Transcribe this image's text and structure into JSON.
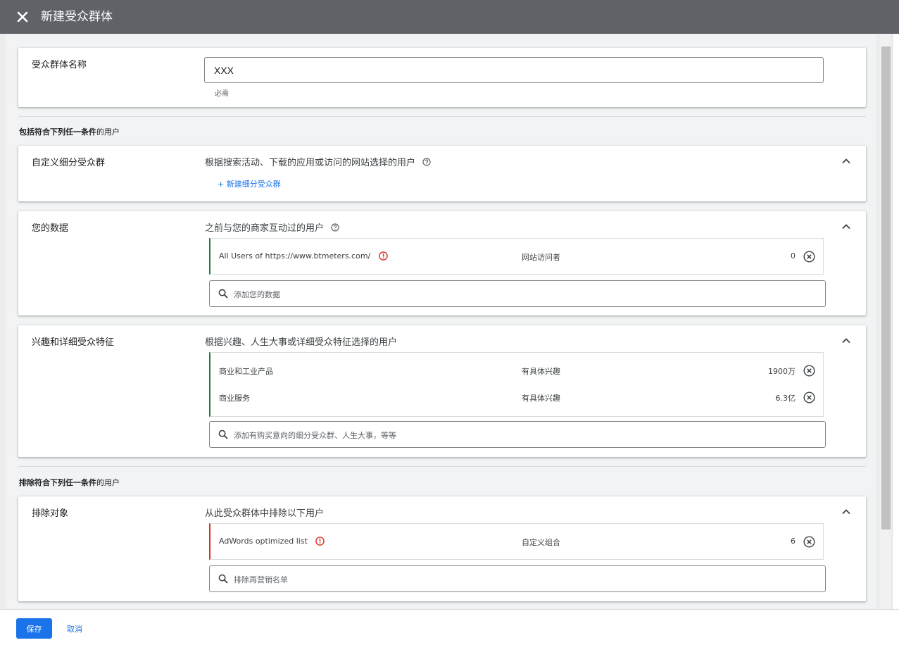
{
  "header": {
    "title": "新建受众群体"
  },
  "name_card": {
    "label": "受众群体名称",
    "input_value": "XXX",
    "required_hint": "必需"
  },
  "include_heading": {
    "bold": "包括符合下列任一条件",
    "rest": "的用户"
  },
  "exclude_heading": {
    "bold": "排除符合下列任一条件",
    "rest": "的用户"
  },
  "custom_segment": {
    "label": "自定义细分受众群",
    "description": "根据搜索活动、下载的应用或访问的网站选择的用户",
    "new_link": "+ 新建细分受众群"
  },
  "your_data": {
    "label": "您的数据",
    "description": "之前与您的商家互动过的用户",
    "rows": [
      {
        "name": "All Users of https://www.btmeters.com/",
        "type": "网站访问者",
        "size": "0",
        "warning": true
      }
    ],
    "search_placeholder": "添加您的数据"
  },
  "interests": {
    "label": "兴趣和详细受众特征",
    "description": "根据兴趣、人生大事或详细受众特征选择的用户",
    "rows": [
      {
        "name": "商业和工业产品",
        "type": "有具体兴趣",
        "size": "1900万"
      },
      {
        "name": "商业服务",
        "type": "有具体兴趣",
        "size": "6.3亿"
      }
    ],
    "search_placeholder": "添加有购买意向的细分受众群、人生大事，等等"
  },
  "exclusions": {
    "label": "排除对象",
    "description": "从此受众群体中排除以下用户",
    "rows": [
      {
        "name": "AdWords optimized list",
        "type": "自定义组合",
        "size": "6",
        "warning": true
      }
    ],
    "search_placeholder": "排除再营销名单"
  },
  "footer": {
    "save_label": "保存",
    "cancel_label": "取消"
  },
  "icons": {
    "close": "close-icon",
    "help": "help-icon",
    "chevron": "chevron-up-icon",
    "warning": "warning-icon",
    "remove": "remove-icon",
    "search": "search-icon"
  },
  "colors": {
    "topbar": "#5f6368",
    "accent": "#1a73e8",
    "include_bar": "#188038",
    "exclude_bar": "#d93025",
    "warning": "#d93025"
  }
}
